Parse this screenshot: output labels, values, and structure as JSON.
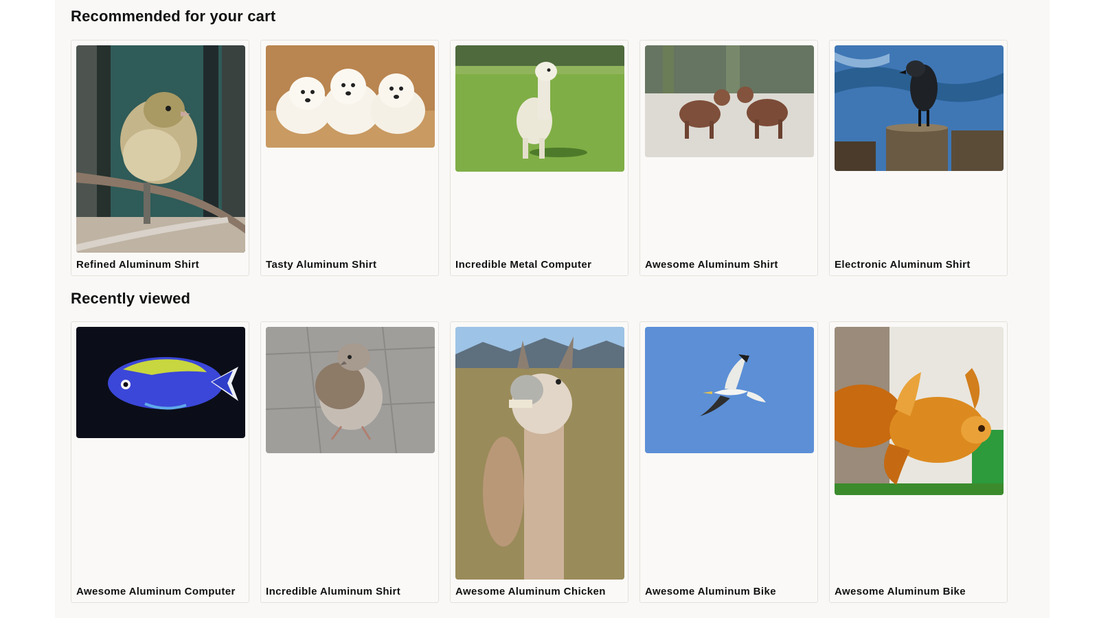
{
  "recommended": {
    "title": "Recommended for your cart",
    "items": [
      {
        "label": "Refined Aluminum Shirt"
      },
      {
        "label": "Tasty Aluminum Shirt"
      },
      {
        "label": "Incredible Metal Computer"
      },
      {
        "label": "Awesome Aluminum Shirt"
      },
      {
        "label": "Electronic Aluminum Shirt"
      }
    ]
  },
  "recent": {
    "title": "Recently viewed",
    "items": [
      {
        "label": "Awesome Aluminum Computer"
      },
      {
        "label": "Incredible Aluminum Shirt"
      },
      {
        "label": "Awesome Aluminum Chicken"
      },
      {
        "label": "Awesome Aluminum Bike"
      },
      {
        "label": "Awesome Aluminum Bike"
      }
    ]
  }
}
